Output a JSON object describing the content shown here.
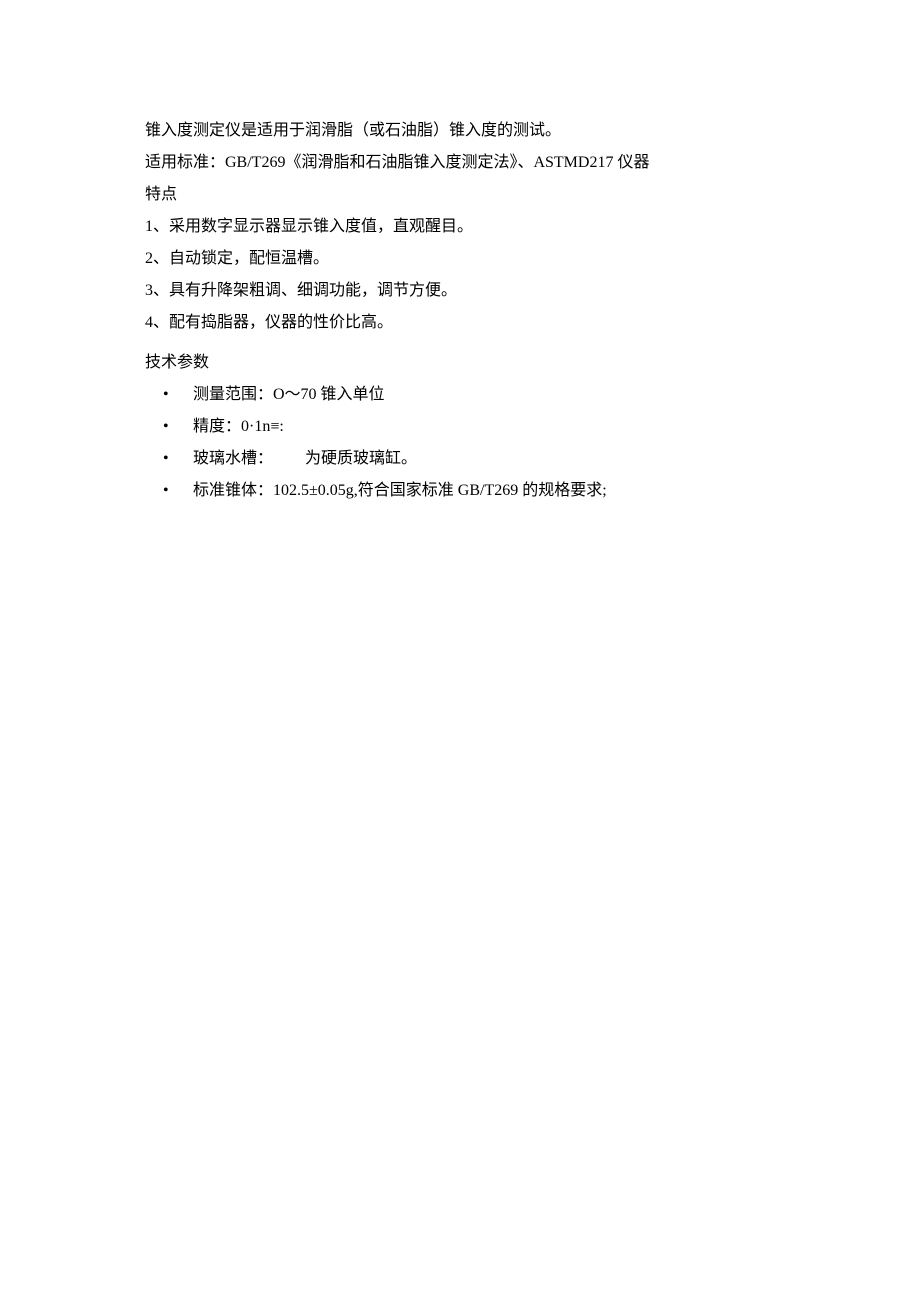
{
  "intro": {
    "line1": "锥入度测定仪是适用于润滑脂（或石油脂）锥入度的测试。",
    "line2": "适用标准：GB/T269《润滑脂和石油脂锥入度测定法》、ASTMD217 仪器",
    "line3": "特点"
  },
  "features": {
    "item1": "1、采用数字显示器显示锥入度值，直观醒目。",
    "item2": "2、自动锁定，配恒温槽。",
    "item3": "3、具有升降架粗调、细调功能，调节方便。",
    "item4": "4、配有捣脂器，仪器的性价比高。"
  },
  "specs_title": "技术参数",
  "specs": {
    "item1": "测量范围：O～70 锥入单位",
    "item2": "精度：0·1n≡:",
    "item3": "玻璃水槽：  为硬质玻璃缸。",
    "item4": "标准锥体：102.5±0.05g,符合国家标准 GB/T269 的规格要求;"
  }
}
